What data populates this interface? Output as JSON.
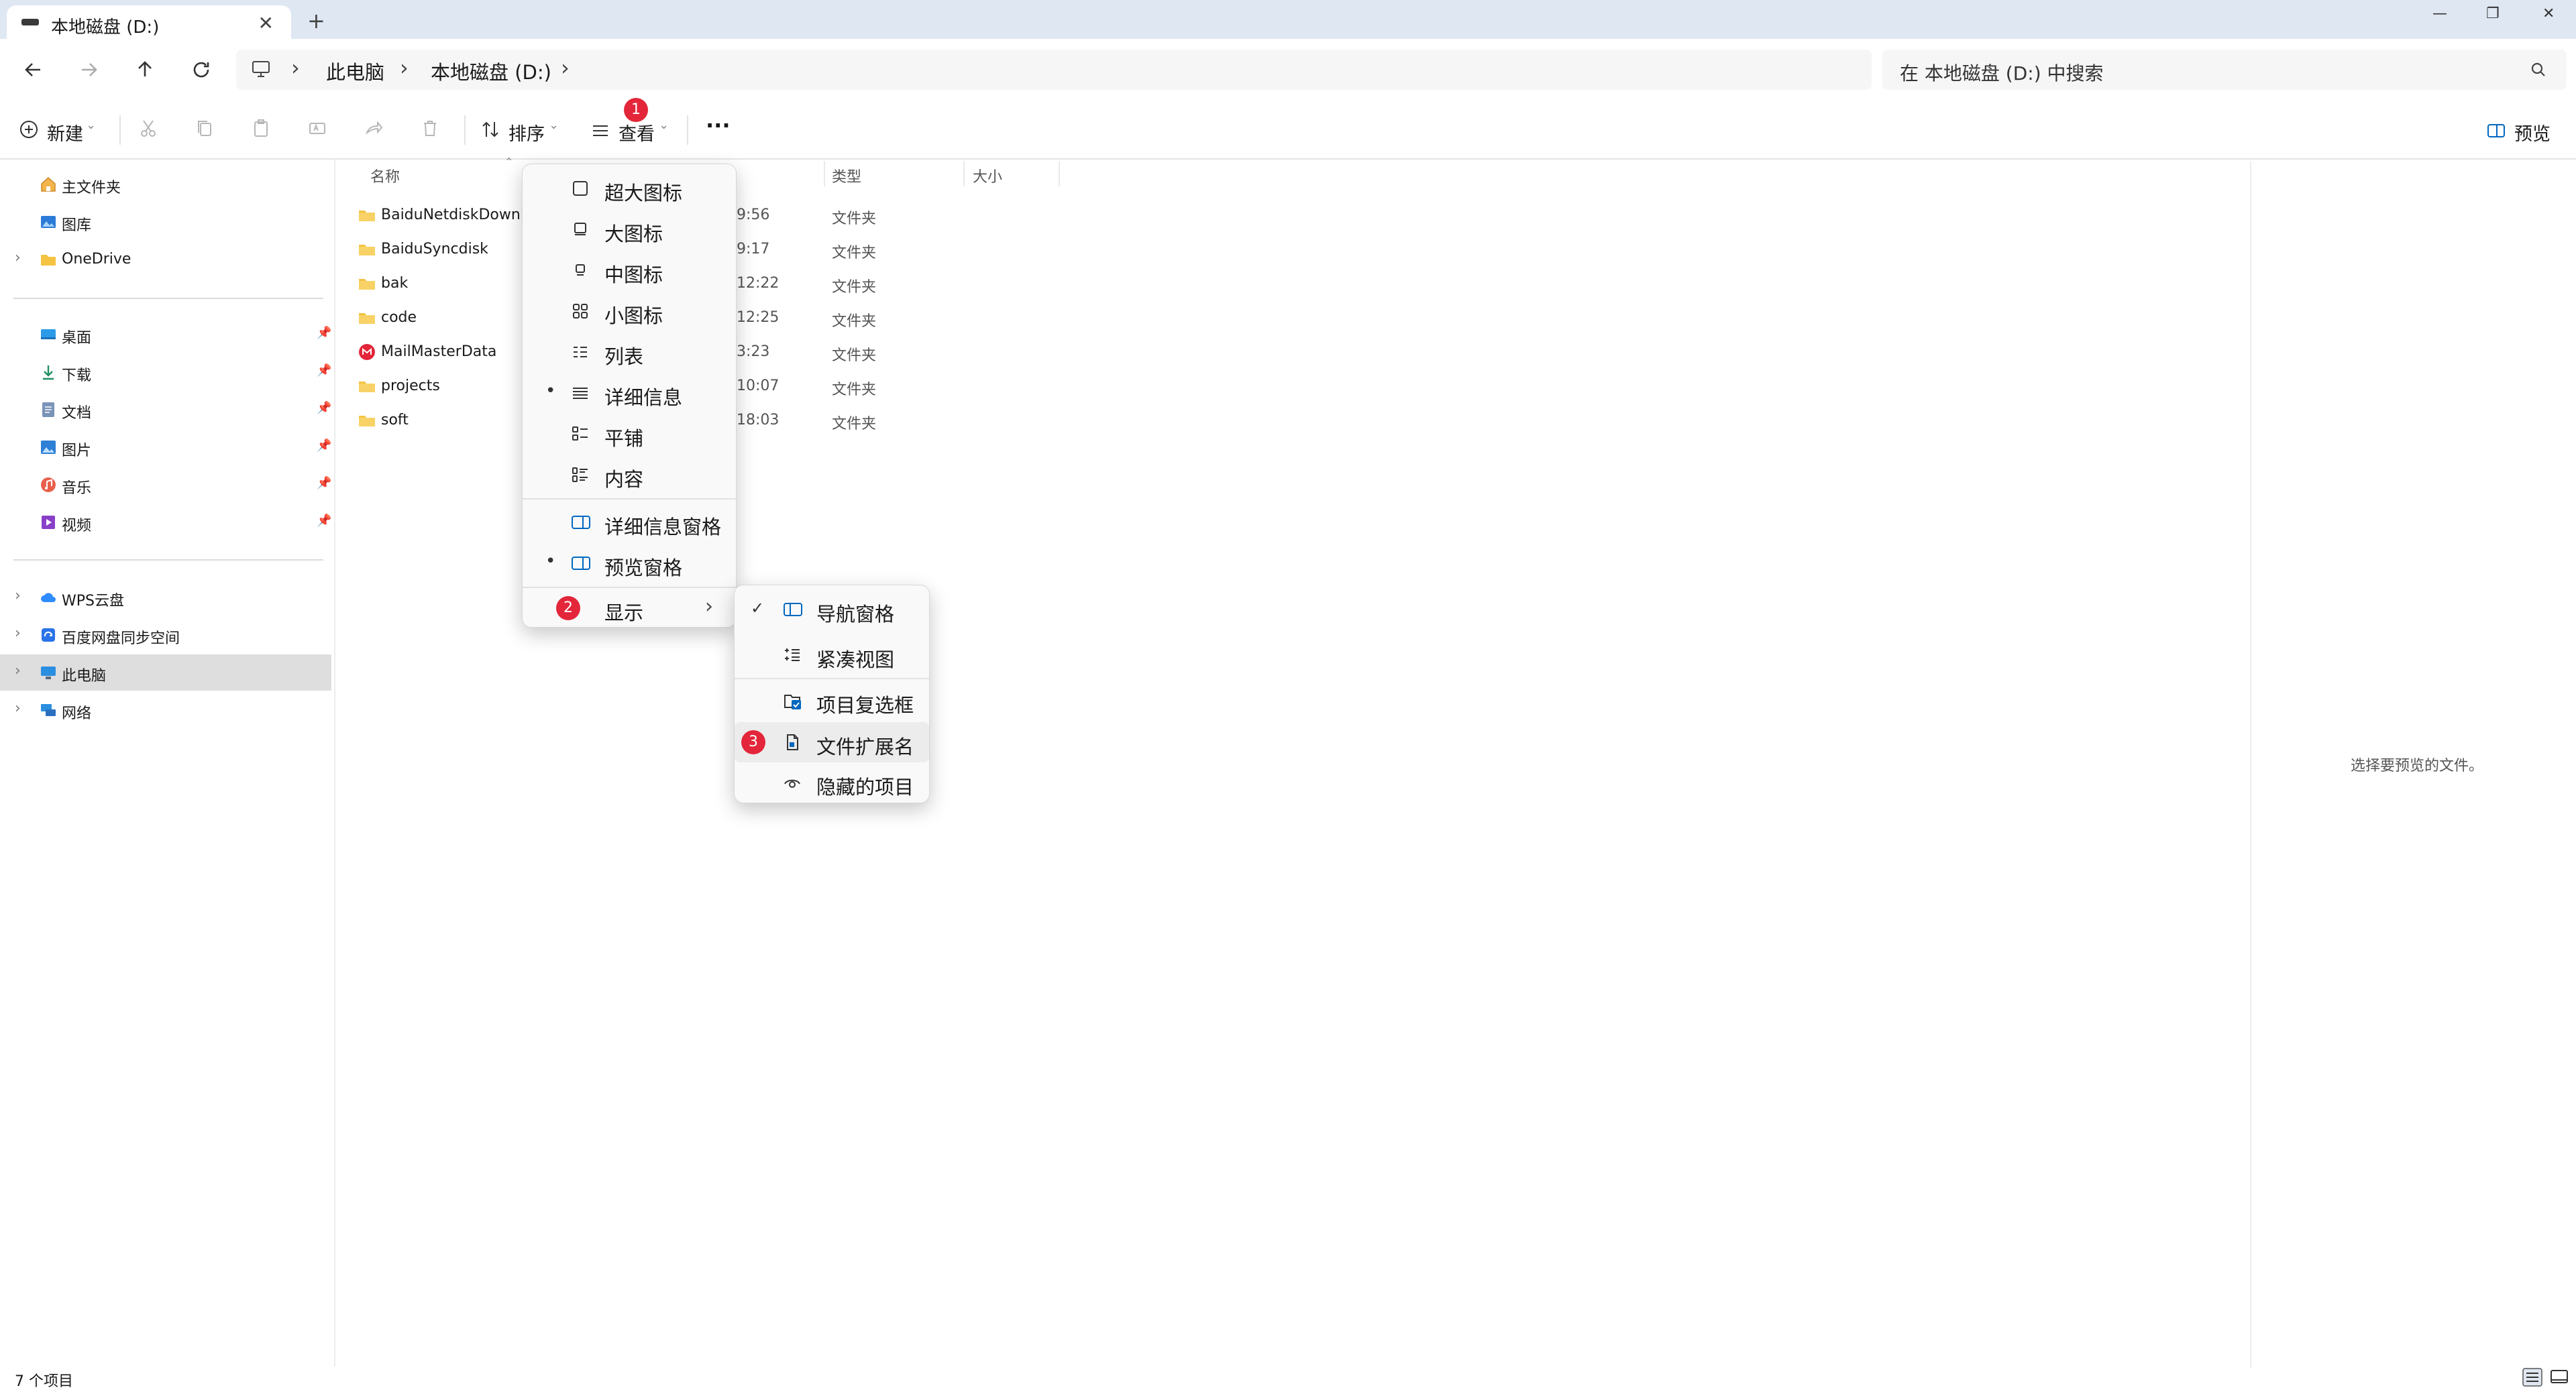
{
  "tab": {
    "title": "本地磁盘 (D:)",
    "close": "✕",
    "new": "+"
  },
  "window": {
    "minimize": "—",
    "restore": "❐",
    "close": "✕"
  },
  "breadcrumb": {
    "items": [
      "此电脑",
      "本地磁盘 (D:)"
    ]
  },
  "search": {
    "placeholder": "在 本地磁盘 (D:) 中搜索"
  },
  "toolbar": {
    "new_label": "新建",
    "sort_label": "排序",
    "view_label": "查看",
    "more_label": "···",
    "preview_label": "预览",
    "badge": "1"
  },
  "sidebar": {
    "items": [
      {
        "label": "主文件夹",
        "icon": "home-icon"
      },
      {
        "label": "图库",
        "icon": "gallery-icon"
      },
      {
        "label": "OneDrive",
        "icon": "folder-icon"
      },
      {
        "label": "桌面",
        "icon": "desktop-icon"
      },
      {
        "label": "下载",
        "icon": "download-icon"
      },
      {
        "label": "文档",
        "icon": "document-icon"
      },
      {
        "label": "图片",
        "icon": "pictures-icon"
      },
      {
        "label": "音乐",
        "icon": "music-icon"
      },
      {
        "label": "视频",
        "icon": "video-icon"
      },
      {
        "label": "WPS云盘",
        "icon": "cloud-icon"
      },
      {
        "label": "百度网盘同步空间",
        "icon": "baidu-sync-icon"
      },
      {
        "label": "此电脑",
        "icon": "computer-icon"
      },
      {
        "label": "网络",
        "icon": "network-icon"
      }
    ]
  },
  "columns": {
    "name": "名称",
    "type": "类型",
    "size": "大小"
  },
  "files": [
    {
      "name": "BaiduNetdiskDownlo",
      "date": "9:56",
      "type": "文件夹"
    },
    {
      "name": "BaiduSyncdisk",
      "date": "9:17",
      "type": "文件夹"
    },
    {
      "name": "bak",
      "date": "12:22",
      "type": "文件夹"
    },
    {
      "name": "code",
      "date": "12:25",
      "type": "文件夹"
    },
    {
      "name": "MailMasterData",
      "date": "3:23",
      "type": "文件夹"
    },
    {
      "name": "projects",
      "date": "10:07",
      "type": "文件夹"
    },
    {
      "name": "soft",
      "date": "18:03",
      "type": "文件夹"
    }
  ],
  "view_menu": {
    "items": [
      {
        "label": "超大图标"
      },
      {
        "label": "大图标"
      },
      {
        "label": "中图标"
      },
      {
        "label": "小图标"
      },
      {
        "label": "列表"
      },
      {
        "label": "详细信息"
      },
      {
        "label": "平铺"
      },
      {
        "label": "内容"
      },
      {
        "label": "详细信息窗格"
      },
      {
        "label": "预览窗格"
      },
      {
        "label": "显示"
      }
    ],
    "bullet": "•",
    "badge": "2"
  },
  "show_menu": {
    "items": [
      {
        "label": "导航窗格"
      },
      {
        "label": "紧凑视图"
      },
      {
        "label": "项目复选框"
      },
      {
        "label": "文件扩展名"
      },
      {
        "label": "隐藏的项目"
      }
    ],
    "check": "✓",
    "badge": "3"
  },
  "preview": {
    "message": "选择要预览的文件。"
  },
  "status": {
    "count": "7 个项目"
  },
  "colors": {
    "accent": "#0067c0",
    "badge": "#e3263a",
    "folder": "#f4c342"
  }
}
